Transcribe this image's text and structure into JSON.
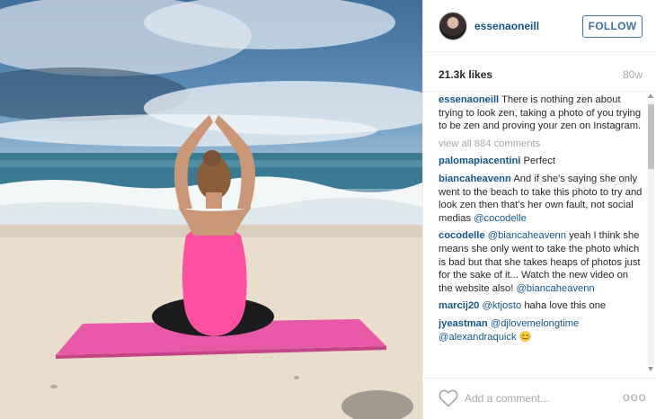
{
  "post": {
    "username": "essenaoneill",
    "follow_label": "FOLLOW",
    "likes": "21.3k likes",
    "age": "80w",
    "caption_user": "essenaoneill",
    "caption_text": "There is nothing zen about trying to look zen, taking a photo of you trying to be zen and proving your zen on Instagram.",
    "view_all": "view all 884 comments"
  },
  "comments": [
    {
      "user": "palomapiacentini",
      "text": "Perfect"
    },
    {
      "user": "biancaheavenn",
      "text": "And if she's saying she only went to the beach to take this photo to try and look zen then that's her own fault, not social medias",
      "mention": "@cocodelle"
    },
    {
      "user": "cocodelle",
      "mention_lead": "@biancaheavenn",
      "text": "yeah I think she means she only went to take the photo which is bad but that she takes heaps of photos just for the sake of it... Watch the new video on the website also!",
      "mention": "@biancaheavenn"
    },
    {
      "user": "marcij20",
      "mention_lead": "@ktjosto",
      "text": "haha love this one"
    },
    {
      "user": "jyeastman",
      "mention_lead": "@djlovemelongtime",
      "mention2": "@alexandraquick",
      "text": "😊"
    }
  ],
  "footer": {
    "placeholder": "Add a comment...",
    "more_label": "ooo"
  },
  "icons": {
    "like": "heart-outline-icon",
    "more": "more-options-icon"
  },
  "colors": {
    "link_blue": "#125688",
    "follow_blue": "#3f729b",
    "muted_gray": "#a5a7aa",
    "mat_pink": "#e85aa8",
    "top_pink": "#ff4fa0"
  }
}
